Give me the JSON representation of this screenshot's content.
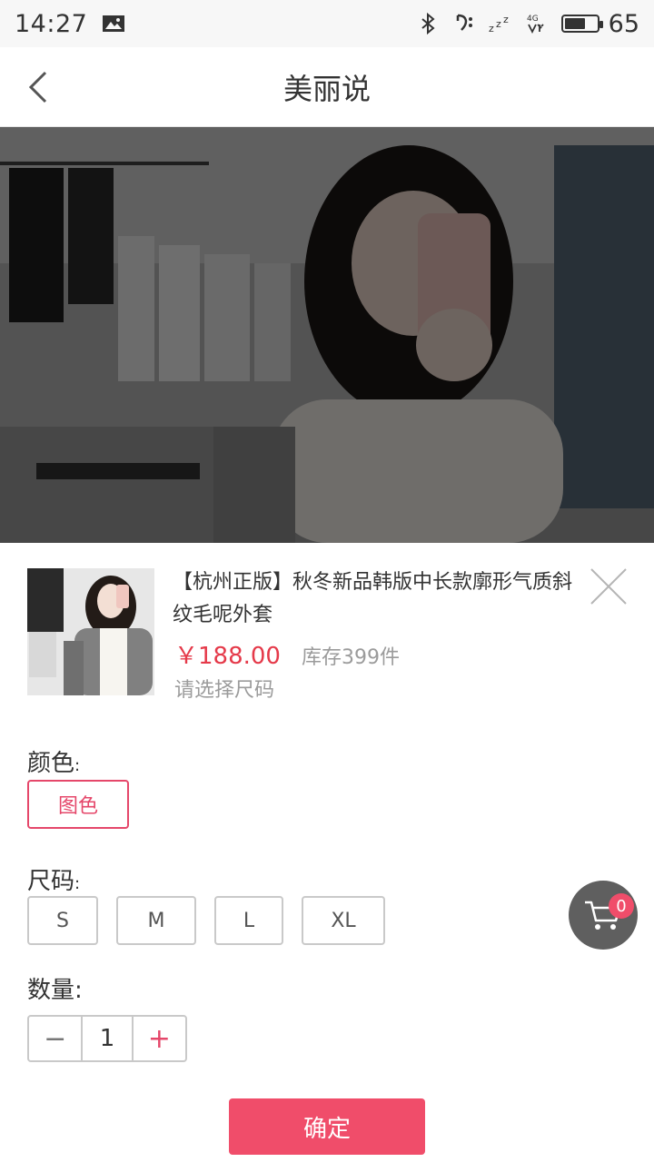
{
  "status_bar": {
    "time": "14:27",
    "battery_level": 65,
    "icons": [
      "image-icon",
      "bluetooth-icon",
      "signal-icon",
      "sleep-icon",
      "4g-icon",
      "battery-icon"
    ]
  },
  "header": {
    "title": "美丽说",
    "back_icon": "chevron-left-icon"
  },
  "product": {
    "name": "【杭州正版】秋冬新品韩版中长款廓形气质斜纹毛呢外套",
    "price": "￥188.00",
    "stock": "库存399件",
    "select_hint": "请选择尺码"
  },
  "options": {
    "color_label": "颜色",
    "colon": ":",
    "colors": [
      {
        "label": "图色",
        "selected": true
      }
    ],
    "size_label": "尺码",
    "sizes": [
      {
        "label": "S",
        "selected": false
      },
      {
        "label": "M",
        "selected": false
      },
      {
        "label": "L",
        "selected": false
      },
      {
        "label": "XL",
        "selected": false
      }
    ],
    "quantity_label": "数量:",
    "quantity": "1",
    "minus": "−",
    "plus": "+"
  },
  "actions": {
    "confirm": "确定"
  },
  "cart": {
    "count": "0"
  },
  "colors": {
    "accent": "#f04d6a",
    "price": "#e53a4a",
    "status_bg": "#f7f7f7"
  }
}
